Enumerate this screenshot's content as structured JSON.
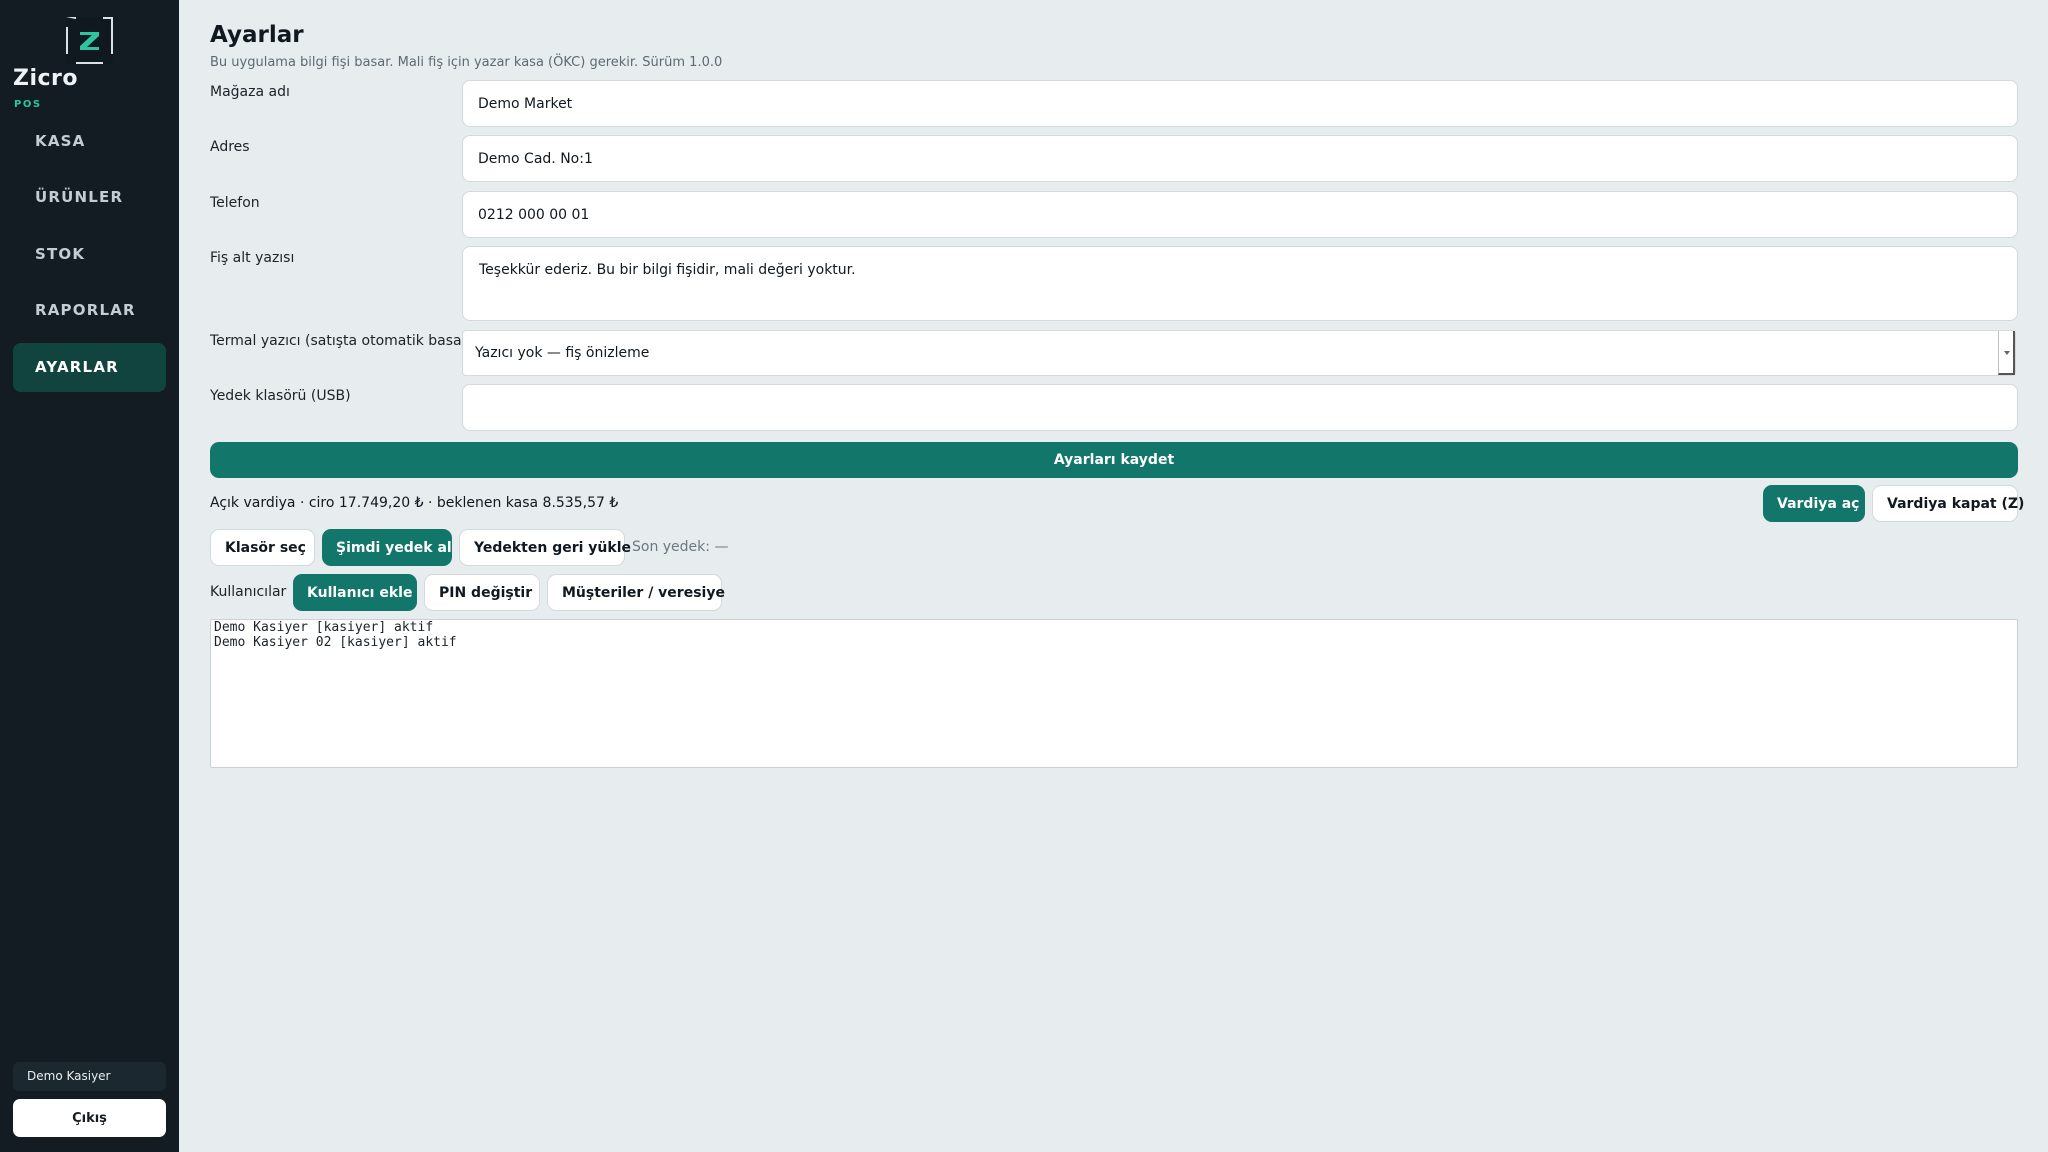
{
  "sidebar": {
    "brand": "Zicro",
    "brand_sub": "POS",
    "items": [
      {
        "label": "KASA"
      },
      {
        "label": "ÜRÜNLER"
      },
      {
        "label": "STOK"
      },
      {
        "label": "RAPORLAR"
      },
      {
        "label": "AYARLAR",
        "active": true
      }
    ],
    "user": "Demo Kasiyer",
    "logout": "Çıkış",
    "logo_icon": "z-logo-icon"
  },
  "header": {
    "title": "Ayarlar",
    "subtitle": "Bu uygulama bilgi fişi basar. Mali fiş için yazar kasa (ÖKC) gerekir. Sürüm 1.0.0"
  },
  "form": {
    "store_name_label": "Mağaza adı",
    "store_name_value": "Demo Market",
    "address_label": "Adres",
    "address_value": "Demo Cad. No:1",
    "phone_label": "Telefon",
    "phone_value": "0212 000 00 01",
    "footer_label": "Fiş alt yazısı",
    "footer_value": "Teşekkür ederiz. Bu bir bilgi fişidir, mali değeri yoktur.",
    "printer_label": "Termal yazıcı (satışta otomatik basar)",
    "printer_value": "Yazıcı yok — fiş önizleme",
    "backup_folder_label": "Yedek klasörü (USB)",
    "backup_folder_value": "",
    "save_label": "Ayarları kaydet"
  },
  "shift": {
    "status": "Açık vardiya · ciro 17.749,20 ₺ · beklenen kasa 8.535,57 ₺",
    "open_label": "Vardiya aç",
    "close_label": "Vardiya kapat (Z)"
  },
  "backup": {
    "choose_folder_label": "Klasör seç",
    "backup_now_label": "Şimdi yedek al",
    "restore_label": "Yedekten geri yükle",
    "last_backup": "Son yedek: —"
  },
  "users": {
    "label": "Kullanıcılar",
    "add_label": "Kullanıcı ekle",
    "change_pin_label": "PIN değiştir",
    "customers_label": "Müşteriler / veresiye",
    "list": [
      "Demo Kasiyer [kasiyer] aktif",
      "Demo Kasiyer 02 [kasiyer] aktif"
    ]
  },
  "colors": {
    "accent": "#12766a",
    "sidebar_bg": "#141c23",
    "brand_accent": "#2ec4a0",
    "page_bg": "#e7ecef"
  }
}
